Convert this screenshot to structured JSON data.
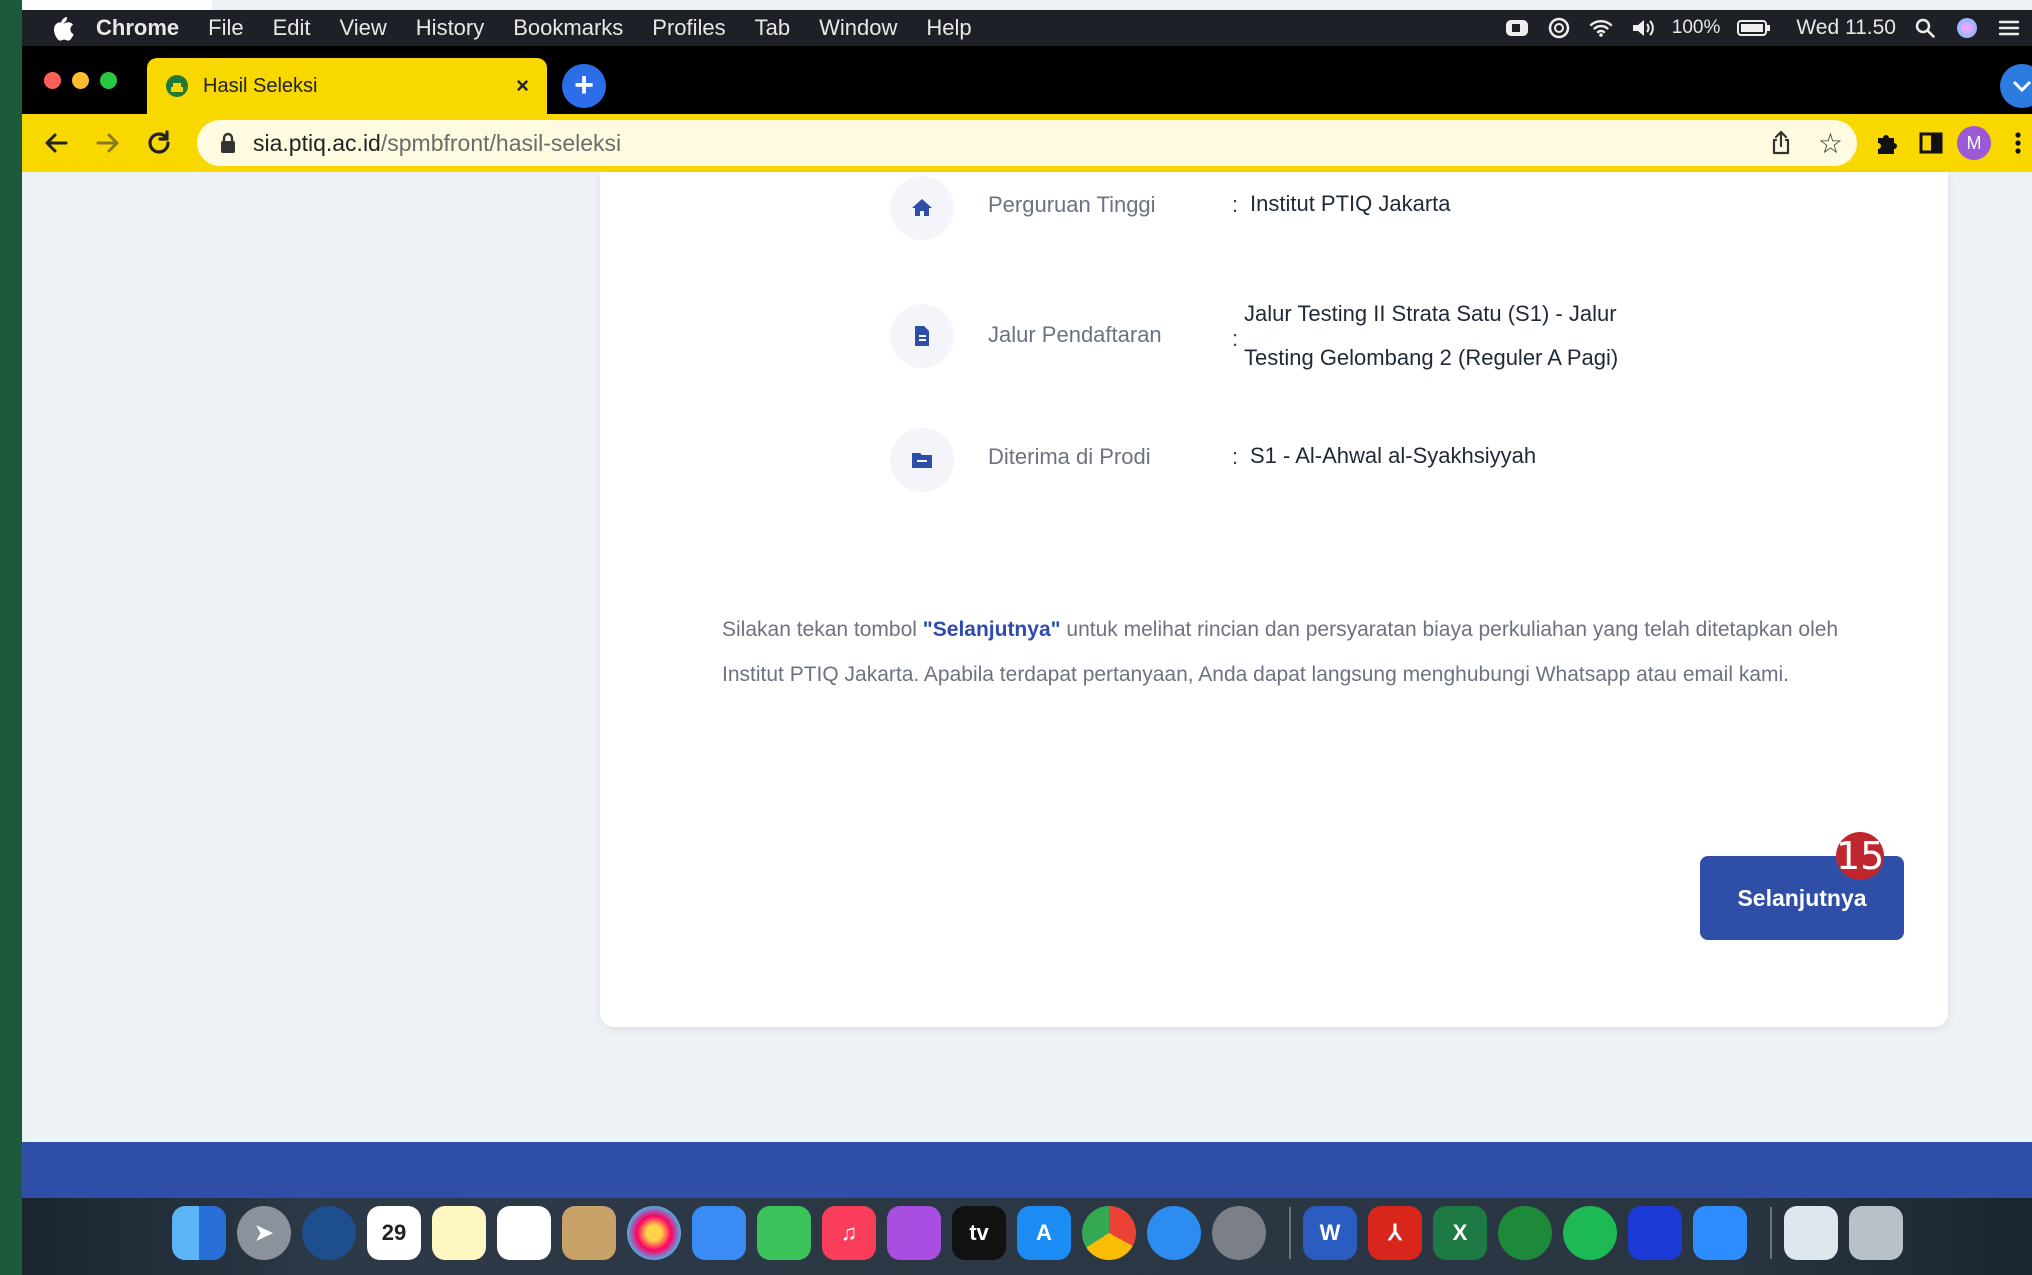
{
  "menubar": {
    "app_name": "Chrome",
    "items": [
      "File",
      "Edit",
      "View",
      "History",
      "Bookmarks",
      "Profiles",
      "Tab",
      "Window",
      "Help"
    ],
    "battery": "100%",
    "clock": "Wed 11.50"
  },
  "tab": {
    "title": "Hasil Seleksi",
    "close": "×",
    "new_tab": "+"
  },
  "address": {
    "host": "sia.ptiq.ac.id",
    "path": "/spmbfront/hasil-seleksi"
  },
  "profile": {
    "initial": "M"
  },
  "info": {
    "rows": [
      {
        "label": "Perguruan Tinggi",
        "value": "Institut PTIQ Jakarta",
        "icon": "home-icon"
      },
      {
        "label": "Jalur Pendaftaran",
        "value_line1": "Jalur Testing II Strata Satu (S1) - Jalur",
        "value_line2": "Testing Gelombang 2 (Reguler A Pagi)",
        "icon": "document-icon"
      },
      {
        "label": "Diterima di Prodi",
        "value": "S1 - Al-Ahwal al-Syakhsiyyah",
        "icon": "folder-icon"
      }
    ]
  },
  "note": {
    "before": "Silakan tekan tombol ",
    "highlight": "\"Selanjutnya\"",
    "after": " untuk melihat rincian dan persyaratan biaya perkuliahan yang telah ditetapkan oleh Institut PTIQ Jakarta. Apabila terdapat pertanyaan, Anda dapat langsung menghubungi Whatsapp atau email kami."
  },
  "button": {
    "next_label": "Selanjutnya"
  },
  "badge": {
    "step": "15"
  },
  "dock": {
    "calendar_day": "29",
    "apple_tv": "tv",
    "word": "W",
    "excel": "X"
  },
  "colors": {
    "accent": "#2f4ea8",
    "chrome_theme": "#f9d800",
    "badge": "#c0262d"
  }
}
